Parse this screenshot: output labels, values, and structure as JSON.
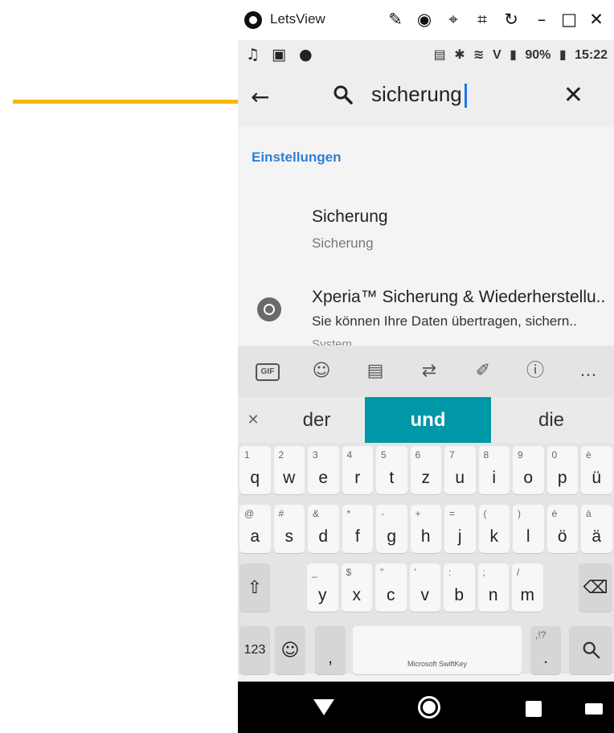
{
  "window": {
    "title": "LetsView",
    "controls": [
      "brush-icon",
      "record-icon",
      "pin-icon",
      "crop-icon",
      "rotate-icon",
      "minimize-icon",
      "maximize-icon",
      "close-icon"
    ]
  },
  "status_bar": {
    "battery": "90%",
    "time": "15:22",
    "network": "V"
  },
  "search": {
    "query": "sicherung"
  },
  "results": {
    "section": "Einstellungen",
    "items": [
      {
        "title": "Sicherung",
        "subtitle": "Sicherung"
      },
      {
        "title": "Xperia™ Sicherung & Wiederherstellu..",
        "subtitle": "Sie können Ihre Daten übertragen, sichern..",
        "category": "System"
      }
    ]
  },
  "keyboard": {
    "suggestions": [
      "der",
      "und",
      "die"
    ],
    "selected_suggestion": 1,
    "accent_color": "#0097a7",
    "brand": "Microsoft SwiftKey",
    "tools": [
      "gif-icon",
      "sticker-icon",
      "clipboard-icon",
      "translate-icon",
      "pen-icon",
      "info-icon",
      "more-icon"
    ],
    "gif_label": "GIF",
    "more_label": "...",
    "row1": [
      {
        "p": "q",
        "s": "1"
      },
      {
        "p": "w",
        "s": "2"
      },
      {
        "p": "e",
        "s": "3"
      },
      {
        "p": "r",
        "s": "4"
      },
      {
        "p": "t",
        "s": "5"
      },
      {
        "p": "z",
        "s": "6"
      },
      {
        "p": "u",
        "s": "7"
      },
      {
        "p": "i",
        "s": "8"
      },
      {
        "p": "o",
        "s": "9"
      },
      {
        "p": "p",
        "s": "0"
      },
      {
        "p": "ü",
        "s": "è"
      }
    ],
    "row2": [
      {
        "p": "a",
        "s": "@"
      },
      {
        "p": "s",
        "s": "#"
      },
      {
        "p": "d",
        "s": "&"
      },
      {
        "p": "f",
        "s": "*"
      },
      {
        "p": "g",
        "s": "-"
      },
      {
        "p": "h",
        "s": "+"
      },
      {
        "p": "j",
        "s": "="
      },
      {
        "p": "k",
        "s": "("
      },
      {
        "p": "l",
        "s": ")"
      },
      {
        "p": "ö",
        "s": "é"
      },
      {
        "p": "ä",
        "s": "à"
      }
    ],
    "row3": [
      {
        "p": "y",
        "s": "_"
      },
      {
        "p": "x",
        "s": "$"
      },
      {
        "p": "c",
        "s": "\""
      },
      {
        "p": "v",
        "s": "'"
      },
      {
        "p": "b",
        "s": ":"
      },
      {
        "p": "n",
        "s": ";"
      },
      {
        "p": "m",
        "s": "/"
      }
    ],
    "numbers_label": "123",
    "comma_label": ",",
    "period_label": ".",
    "period_secondary": ",!?"
  }
}
